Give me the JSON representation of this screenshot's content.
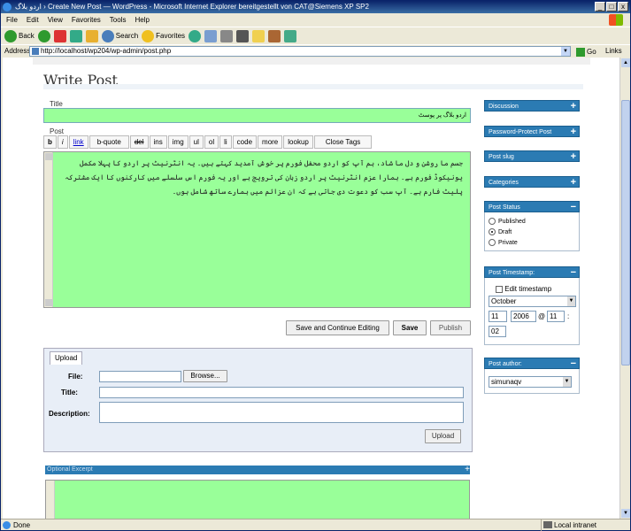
{
  "window": {
    "title": "اردو بلاگ › Create New Post — WordPress - Microsoft Internet Explorer bereitgestellt von CAT@Siemens XP SP2",
    "buttons": [
      "_",
      "□",
      "x"
    ]
  },
  "menu": [
    "File",
    "Edit",
    "View",
    "Favorites",
    "Tools",
    "Help"
  ],
  "toolbar": {
    "back": "Back",
    "search": "Search",
    "favorites": "Favorites"
  },
  "address": {
    "label": "Address",
    "url": "http://localhost/wp204/wp-admin/post.php",
    "go": "Go",
    "links": "Links"
  },
  "page": {
    "heading": "Write Post",
    "title_label": "Title",
    "title_value": "اردو بلاگ پر پوسٹ",
    "post_label": "Post",
    "quicktags": [
      "b",
      "i",
      "link",
      "b-quote",
      "del",
      "ins",
      "img",
      "ul",
      "ol",
      "li",
      "code",
      "more",
      "lookup",
      "Close Tags"
    ],
    "post_text": "جسم ما روشن و دل ما شاد، ہم آپ کو اردو محفل فورم پر خوش آمدید کہتے ہیں۔ یہ انٹرنیٹ پر اردو کا پہلا مکمل یونیکوڈ فورم ہے۔ ہمارا عزم انٹرنیٹ پر اردو زبان کی ترویج ہے اور یہ فورم اس سلسلے میں کارکنوں کا ایک مشترکہ پلیٹ فارم ہے۔ آپ سب کو دعوت دی جاتی ہے کہ ان عزائم میں ہمارے ساتھ شامل ہوں۔",
    "buttons": {
      "save_continue": "Save and Continue Editing",
      "save": "Save",
      "publish": "Publish"
    },
    "upload": {
      "tab": "Upload",
      "file_label": "File:",
      "browse": "Browse...",
      "title_label": "Title:",
      "description_label": "Description:",
      "submit": "Upload"
    },
    "excerpt": {
      "label": "Optional Excerpt",
      "toggle": "+"
    }
  },
  "sidebar": {
    "discussion": "Discussion",
    "password": "Password-Protect Post",
    "slug": "Post slug",
    "categories": "Categories",
    "status": {
      "label": "Post Status",
      "options": [
        "Published",
        "Draft",
        "Private"
      ],
      "selected": "Draft"
    },
    "timestamp": {
      "label": "Post Timestamp:",
      "edit": "Edit timestamp",
      "month": "October",
      "day": "11",
      "year": "2006",
      "at": "@",
      "hour": "11",
      "colon": ":",
      "minute": "02"
    },
    "author": {
      "label": "Post author:",
      "value": "simunaqv"
    },
    "plus": "+",
    "minus": "−"
  },
  "status": {
    "text": "Done",
    "zone": "Local intranet"
  }
}
